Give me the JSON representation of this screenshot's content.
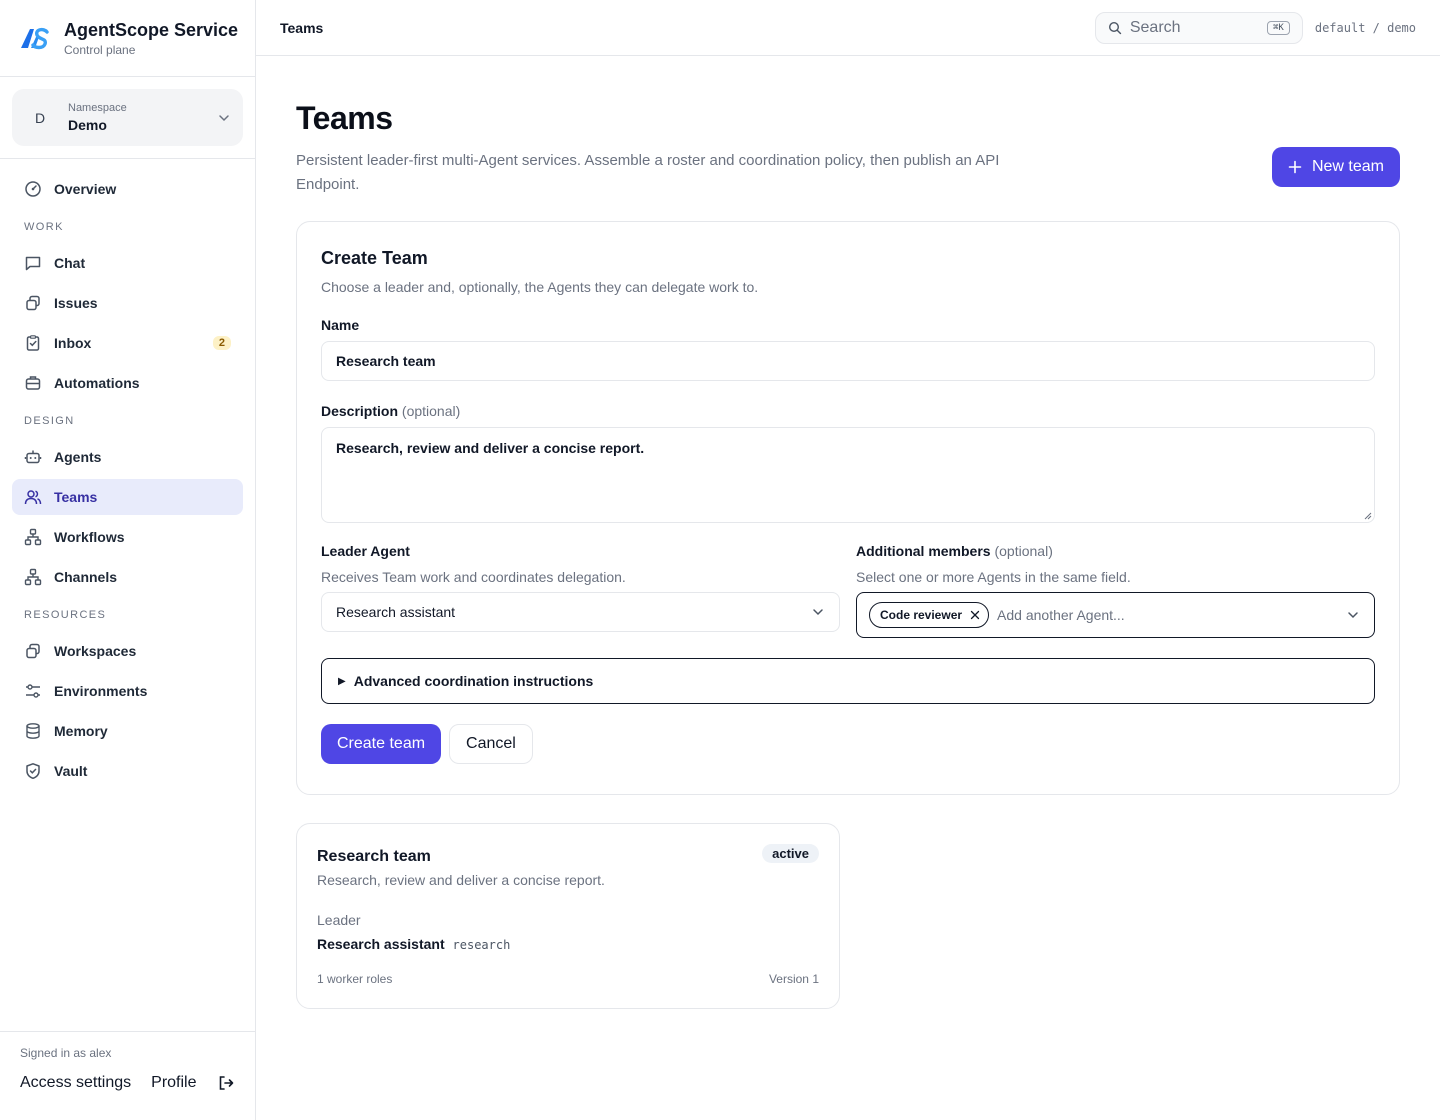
{
  "brand": {
    "name": "AgentScope Service",
    "subtitle": "Control plane"
  },
  "namespace": {
    "label": "Namespace",
    "value": "Demo",
    "initial": "D"
  },
  "nav": {
    "overview": "Overview",
    "sections": {
      "work": "WORK",
      "design": "DESIGN",
      "resources": "RESOURCES"
    },
    "work": [
      {
        "label": "Chat",
        "icon": "chat-icon"
      },
      {
        "label": "Issues",
        "icon": "issues-icon"
      },
      {
        "label": "Inbox",
        "icon": "inbox-icon",
        "badge": "2"
      },
      {
        "label": "Automations",
        "icon": "automations-icon"
      }
    ],
    "design": [
      {
        "label": "Agents",
        "icon": "robot-icon"
      },
      {
        "label": "Teams",
        "icon": "users-icon",
        "active": true
      },
      {
        "label": "Workflows",
        "icon": "workflow-icon"
      },
      {
        "label": "Channels",
        "icon": "channels-icon"
      }
    ],
    "resources": [
      {
        "label": "Workspaces",
        "icon": "workspaces-icon"
      },
      {
        "label": "Environments",
        "icon": "sliders-icon"
      },
      {
        "label": "Memory",
        "icon": "database-icon"
      },
      {
        "label": "Vault",
        "icon": "shield-icon"
      }
    ]
  },
  "footer": {
    "signed_in": "Signed in as alex",
    "access_settings": "Access settings",
    "profile": "Profile"
  },
  "topbar": {
    "title": "Teams",
    "search_placeholder": "Search",
    "shortcut": "⌘K",
    "context": "default / demo"
  },
  "page": {
    "title": "Teams",
    "description": "Persistent leader-first multi-Agent services. Assemble a roster and coordination policy, then publish an API Endpoint.",
    "new_button": "New team"
  },
  "form": {
    "title": "Create Team",
    "subtitle": "Choose a leader and, optionally, the Agents they can delegate work to.",
    "name_label": "Name",
    "name_value": "Research team",
    "description_label": "Description",
    "optional": "(optional)",
    "description_value": "Research, review and deliver a concise report.",
    "leader_label": "Leader Agent",
    "leader_help": "Receives Team work and coordinates delegation.",
    "leader_value": "Research assistant",
    "members_label": "Additional members",
    "members_help": "Select one or more Agents in the same field.",
    "members_chip": "Code reviewer",
    "members_placeholder": "Add another Agent...",
    "advanced": "Advanced coordination instructions",
    "submit": "Create team",
    "cancel": "Cancel"
  },
  "team_card": {
    "name": "Research team",
    "status": "active",
    "description": "Research, review and deliver a concise report.",
    "leader_label": "Leader",
    "leader_name": "Research assistant",
    "leader_slug": "research",
    "worker_roles": "1 worker roles",
    "version": "Version 1"
  },
  "colors": {
    "accent": "#4f46e5",
    "active_nav_bg": "#e8ebfb",
    "active_nav_text": "#3730a3",
    "badge_bg": "#fdf1c6"
  }
}
